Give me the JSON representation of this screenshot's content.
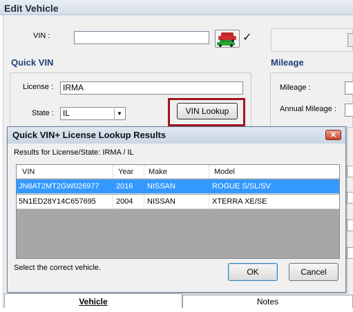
{
  "window": {
    "title": "Edit Vehicle"
  },
  "vin": {
    "label": "VIN :",
    "value": ""
  },
  "quick_vin": {
    "section_title": "Quick VIN",
    "license_label": "License :",
    "license_value": "IRMA",
    "state_label": "State :",
    "state_value": "IL",
    "lookup_button": "VIN Lookup"
  },
  "mileage": {
    "section_title": "Mileage",
    "mileage_label": "Mileage :",
    "annual_label": "Annual Mileage :"
  },
  "dialog": {
    "title": "Quick VIN+ License Lookup Results",
    "close_glyph": "✕",
    "results_label": "Results for License/State:  IRMA / IL",
    "columns": [
      "VIN",
      "Year",
      "Make",
      "Model"
    ],
    "rows": [
      {
        "vin": "JN8AT2MT2GW026977",
        "year": "2016",
        "make": "NISSAN",
        "model": "ROGUE S/SL/SV"
      },
      {
        "vin": "5N1ED28Y14C657695",
        "year": "2004",
        "make": "NISSAN",
        "model": "XTERRA XE/SE"
      }
    ],
    "hint": "Select the correct vehicle.",
    "ok": "OK",
    "cancel": "Cancel"
  },
  "tabs": {
    "vehicle": "Vehicle",
    "notes": "Notes"
  },
  "icons": {
    "car": "cars-icon",
    "check": "checkmark-icon",
    "dropdown": "chevron-down-icon"
  },
  "colors": {
    "highlight": "#3399ff",
    "lookup_frame": "#a0161d",
    "section_title": "#1f3f77"
  }
}
